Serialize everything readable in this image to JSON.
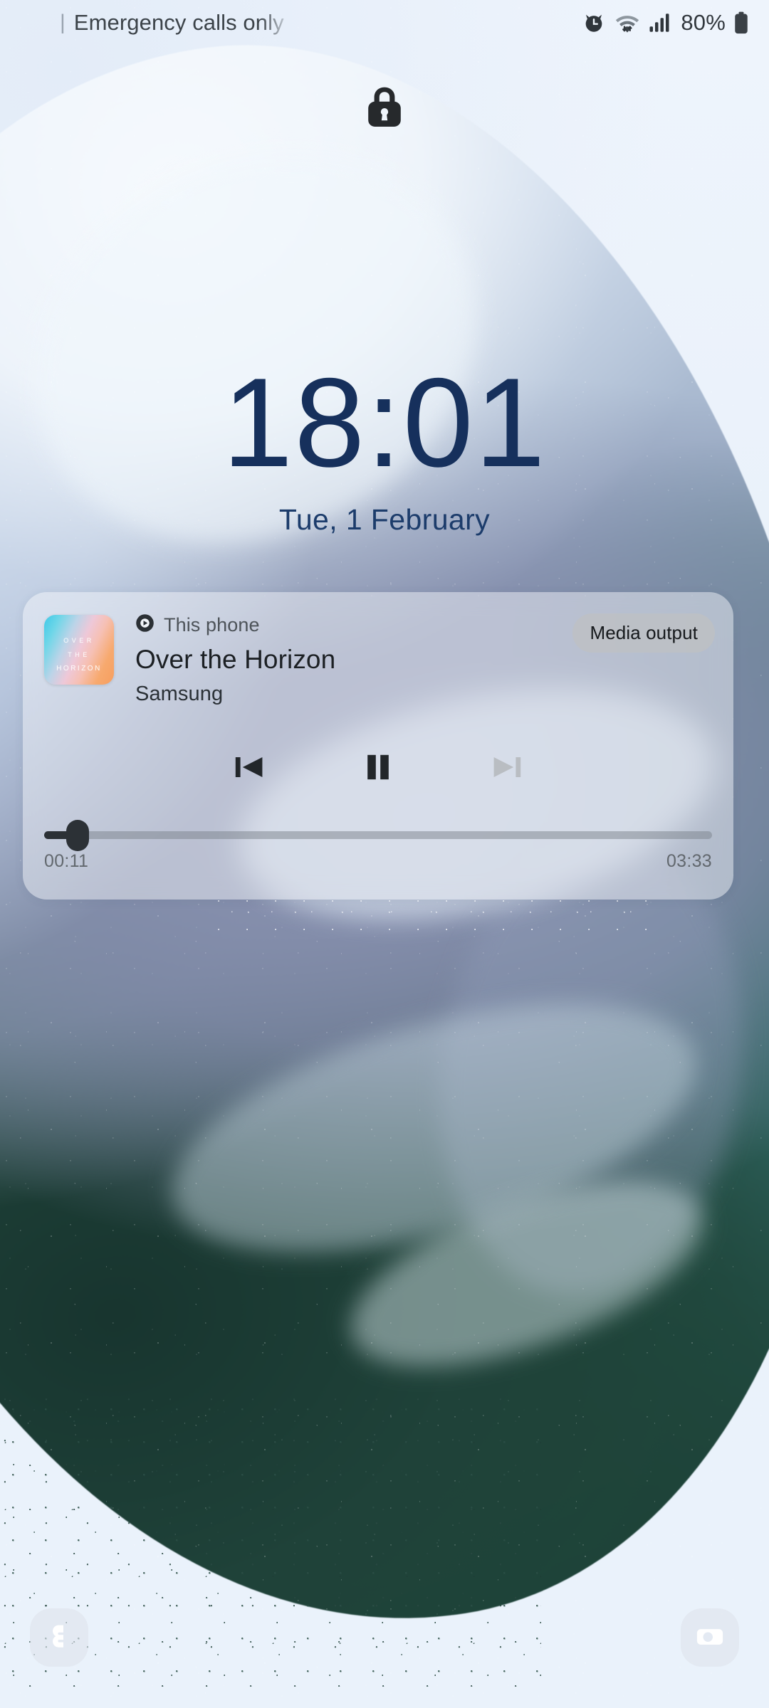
{
  "status_bar": {
    "sim_divider": "|",
    "carrier_text": "Emergency calls only",
    "alarm_icon": "alarm-clock-icon",
    "wifi_icon": "wifi-data-transfer-icon",
    "signal_icon": "cellular-signal-icon",
    "battery_percent": "80%",
    "battery_icon": "battery-full-icon"
  },
  "lock": {
    "icon": "lock-closed-icon"
  },
  "clock": {
    "time": "18:01",
    "date": "Tue, 1 February",
    "color": "#16305c"
  },
  "media": {
    "source_icon": "media-output-target-icon",
    "source_label": "This phone",
    "title": "Over the Horizon",
    "artist": "Samsung",
    "output_button_label": "Media output",
    "album_art": {
      "line1": "OVER",
      "line2": "THE",
      "line3": "HORIZON",
      "gradient_from": "#3ec9e8",
      "gradient_mid": "#eec8d8",
      "gradient_to": "#f79e5e"
    },
    "controls": {
      "previous_icon": "skip-previous-icon",
      "play_pause_icon": "pause-icon",
      "next_icon": "skip-next-icon",
      "next_disabled": true
    },
    "progress": {
      "elapsed": "00:11",
      "duration": "03:33",
      "percent": 5
    }
  },
  "shortcuts": {
    "left": {
      "icon": "phone-handset-icon",
      "name": "phone"
    },
    "right": {
      "icon": "camera-icon",
      "name": "camera"
    }
  },
  "theme": {
    "wallpaper_base": "#eaf2fb",
    "accent_text": "#16305c",
    "card_bg": "rgba(244,247,250,0.48)"
  }
}
